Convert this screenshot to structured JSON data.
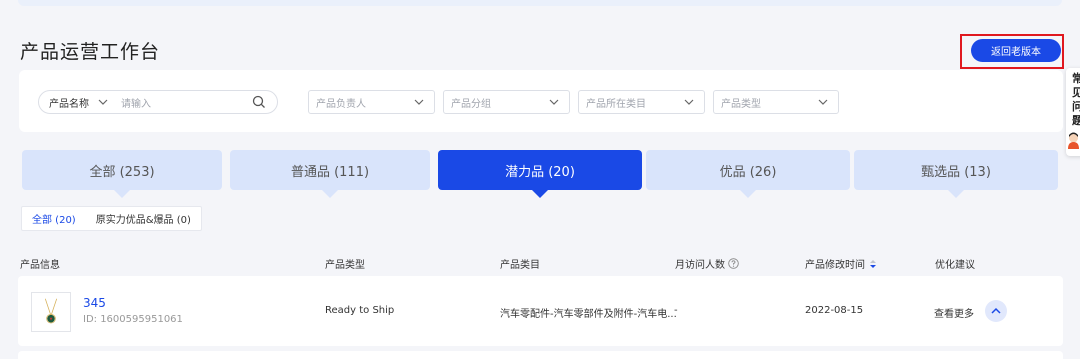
{
  "header": {
    "title": "产品运营工作台",
    "back_button": "返回老版本"
  },
  "side_helper": {
    "text": "常见问题",
    "icon": "avatar-icon"
  },
  "filters": {
    "search_field_label": "产品名称",
    "search_placeholder": "请输入",
    "owner": "产品负责人",
    "group": "产品分组",
    "category": "产品所在类目",
    "type": "产品类型"
  },
  "tabs": [
    {
      "label": "全部 (253)",
      "active": false
    },
    {
      "label": "普通品 (111)",
      "active": false
    },
    {
      "label": "潜力品 (20)",
      "active": true
    },
    {
      "label": "优品 (26)",
      "active": false
    },
    {
      "label": "甄选品 (13)",
      "active": false
    }
  ],
  "subtabs": [
    {
      "label": "全部 (20)",
      "active": true
    },
    {
      "label": "原实力优品&爆品 (0)",
      "active": false
    }
  ],
  "table": {
    "headers": {
      "info": "产品信息",
      "type": "产品类型",
      "category": "产品类目",
      "visitors": "月访问人数",
      "modified": "产品修改时间",
      "advice": "优化建议"
    },
    "rows": [
      {
        "name": "345",
        "id": "ID: 1600595951061",
        "type": "Ready to Ship",
        "category": "汽车零配件-汽车零部件及附件-汽车电...",
        "visitors": "-",
        "modified": "2022-08-15",
        "advice": "查看更多"
      }
    ]
  },
  "colors": {
    "primary": "#1a49e6",
    "tab_bg": "#d9e4fb",
    "highlight_border": "#e0181f"
  }
}
